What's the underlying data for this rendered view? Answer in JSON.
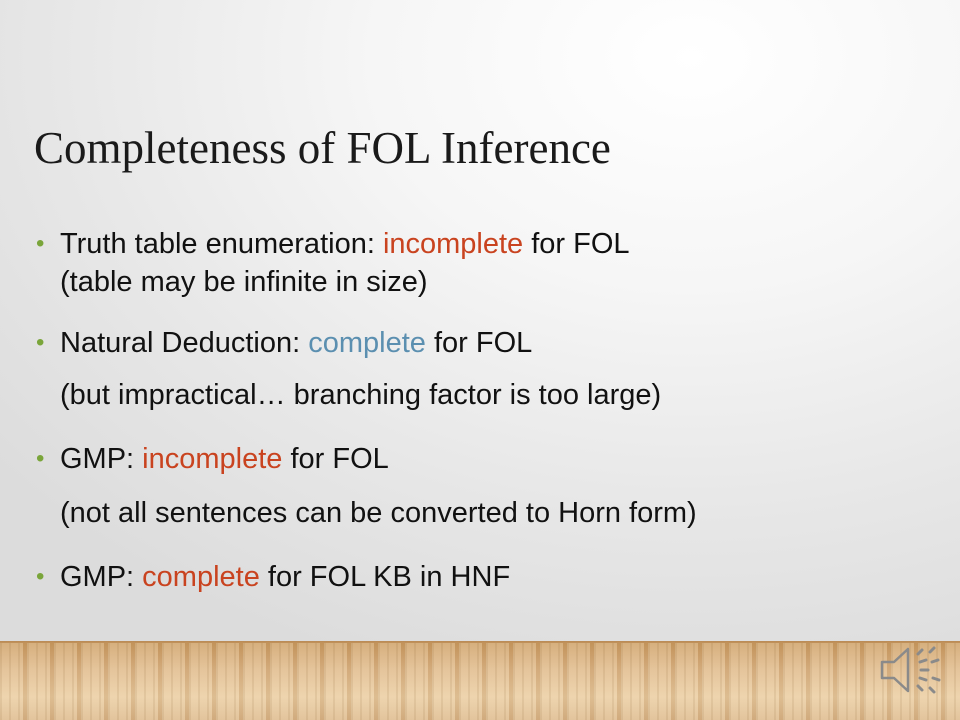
{
  "slide": {
    "title": "Completeness of FOL Inference",
    "bullets": [
      {
        "before": "Truth table enumeration: ",
        "highlight": "incomplete",
        "highlight_color": "#c9431f",
        "after": " for FOL",
        "subline": "(table may be infinite in size)"
      },
      {
        "before": "Natural Deduction: ",
        "highlight": "complete",
        "highlight_color": "#5b8fb0",
        "after": " for FOL",
        "subline": "(but impractical… branching factor is too large)"
      },
      {
        "before": "GMP: ",
        "highlight": "incomplete",
        "highlight_color": "#c9431f",
        "after": " for FOL",
        "subline": "(not all sentences can be converted to Horn form)"
      },
      {
        "before": "GMP: ",
        "highlight": "complete",
        "highlight_color": "#c9431f",
        "after": " for FOL KB in HNF"
      }
    ],
    "bullet_symbol": "•",
    "bullet_color": "#7aa53a",
    "audio_icon": "speaker-icon"
  }
}
